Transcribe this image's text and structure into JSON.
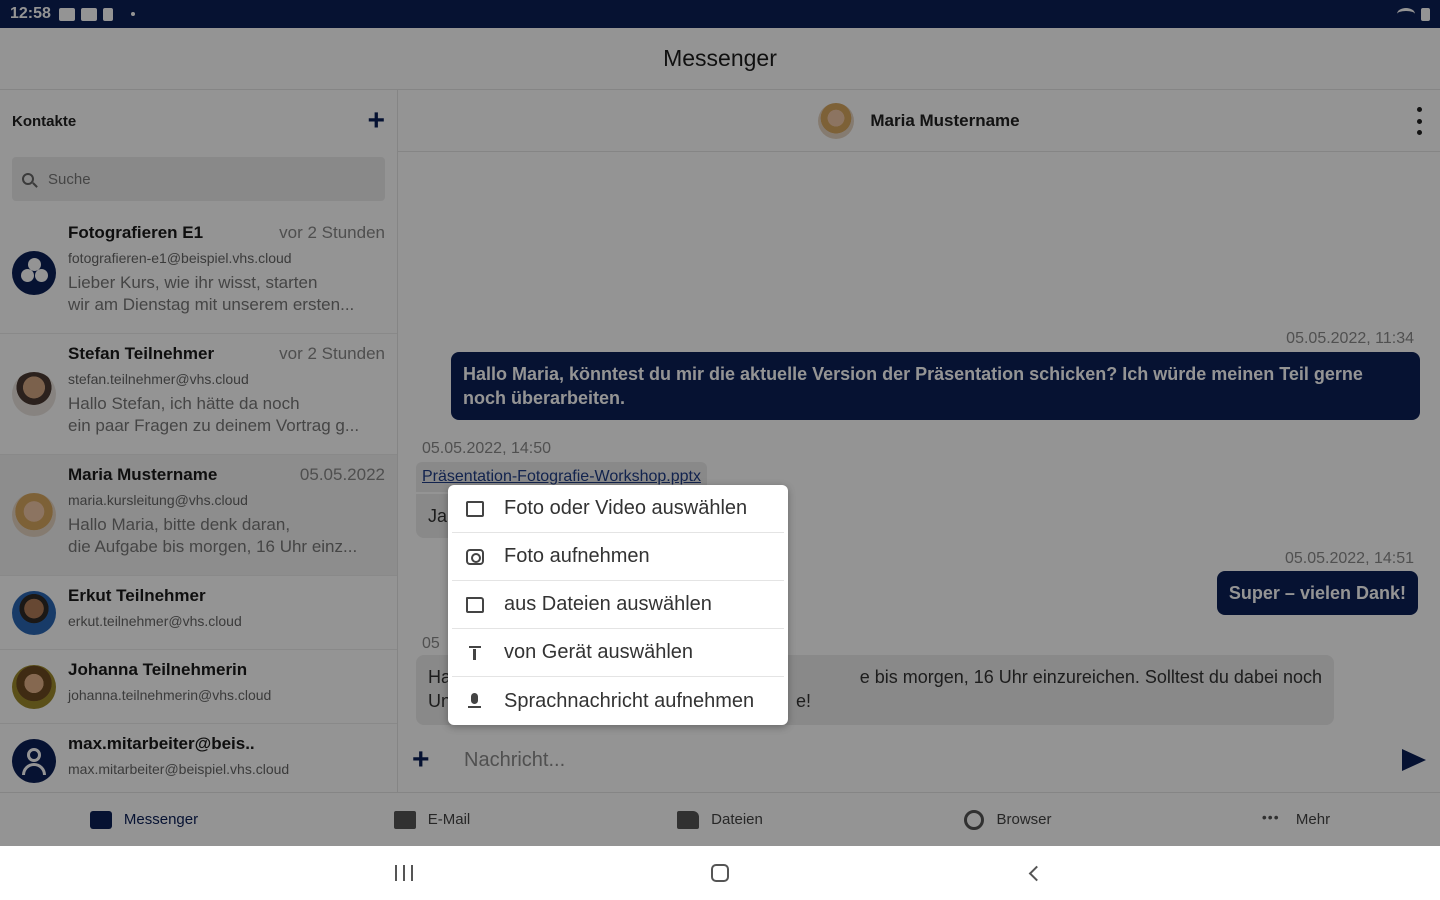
{
  "status_bar": {
    "time": "12:58"
  },
  "app": {
    "title": "Messenger"
  },
  "sidebar": {
    "header": "Kontakte",
    "search_placeholder": "Suche",
    "contacts": [
      {
        "name": "Fotografieren E1",
        "time": "vor 2 Stunden",
        "email": "fotografieren-e1@beispiel.vhs.cloud",
        "preview_line1": "Lieber Kurs,  wie ihr wisst, starten",
        "preview_line2": "wir am Dienstag mit unserem ersten..."
      },
      {
        "name": "Stefan Teilnehmer",
        "time": "vor 2 Stunden",
        "email": "stefan.teilnehmer@vhs.cloud",
        "preview_line1": "Hallo Stefan,  ich hätte da noch",
        "preview_line2": "ein paar Fragen zu deinem Vortrag g..."
      },
      {
        "name": "Maria Mustername",
        "time": "05.05.2022",
        "email": "maria.kursleitung@vhs.cloud",
        "preview_line1": "Hallo Maria, bitte denk daran,",
        "preview_line2": "die Aufgabe bis morgen, 16 Uhr einz..."
      },
      {
        "name": "Erkut Teilnehmer",
        "time": "",
        "email": "erkut.teilnehmer@vhs.cloud"
      },
      {
        "name": "Johanna Teilnehmerin",
        "time": "",
        "email": "johanna.teilnehmerin@vhs.cloud"
      },
      {
        "name": "max.mitarbeiter@beis..",
        "time": "",
        "email": "max.mitarbeiter@beispiel.vhs.cloud"
      }
    ]
  },
  "chat": {
    "contact_name": "Maria Mustername",
    "messages": {
      "m1_time": "05.05.2022, 11:34",
      "m1_text_line1": "Hallo Maria, könntest du mir die aktuelle Version der Präsentation schicken? Ich würde meinen Teil gerne",
      "m1_text_line2": "noch überarbeiten.",
      "m2_time": "05.05.2022, 14:50",
      "m2_attachment": "Präsentation-Fotografie-Workshop.pptx",
      "m2_text": "Ja",
      "m3_time": "05.05.2022, 14:51",
      "m3_text": "Super – vielen Dank!",
      "m4_time": "05",
      "m4_text_line1_start": "Ha",
      "m4_text_line1_end": "e bis  morgen, 16 Uhr  einzureichen. Solltest du dabei noch",
      "m4_text_line2_start": "Un",
      "m4_text_line2_end": "e!"
    },
    "composer_placeholder": "Nachricht..."
  },
  "attach_menu": {
    "items": [
      {
        "label": "Foto oder Video auswählen",
        "icon": "image-icon"
      },
      {
        "label": "Foto aufnehmen",
        "icon": "camera-icon"
      },
      {
        "label": "aus Dateien auswählen",
        "icon": "folder-icon"
      },
      {
        "label": "von Gerät auswählen",
        "icon": "upload-icon"
      },
      {
        "label": "Sprachnachricht aufnehmen",
        "icon": "microphone-icon"
      }
    ]
  },
  "bottom_nav": {
    "items": [
      {
        "label": "Messenger",
        "icon": "messenger-icon"
      },
      {
        "label": "E-Mail",
        "icon": "mail-icon"
      },
      {
        "label": "Dateien",
        "icon": "files-icon"
      },
      {
        "label": "Browser",
        "icon": "globe-icon"
      },
      {
        "label": "Mehr",
        "icon": "more-icon"
      }
    ]
  },
  "colors": {
    "brand": "#0b1f57",
    "status_bar": "#0b1f57",
    "incoming_bubble": "#ececec"
  }
}
